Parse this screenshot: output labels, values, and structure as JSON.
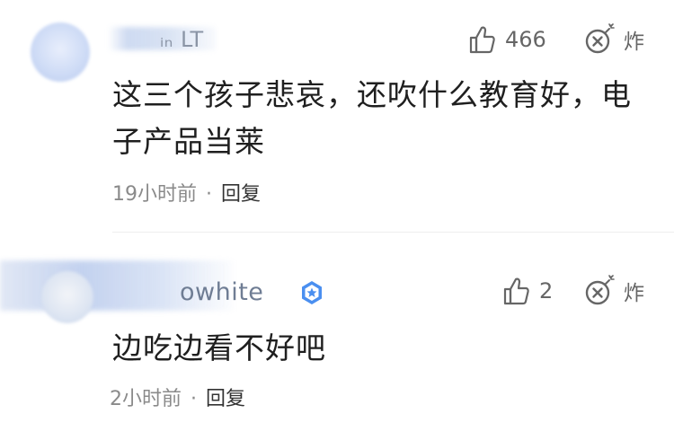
{
  "comments": [
    {
      "username": "ᵢₙ LT",
      "likes": "466",
      "bomb_label": "炸",
      "content_line1": "这三个孩子悲哀，还吹什么教育好，电",
      "content_line2": "子产品当莱",
      "time": "19小时前",
      "separator": "·",
      "reply": "回复"
    },
    {
      "username": "owhite",
      "likes": "2",
      "bomb_label": "炸",
      "content_line1": "边吃边看不好吧",
      "time": "2小时前",
      "separator": "·",
      "reply": "回复"
    }
  ],
  "colors": {
    "text": "#1f1f1f",
    "meta": "#8a8a8a",
    "badge": "#4a8ff0"
  }
}
